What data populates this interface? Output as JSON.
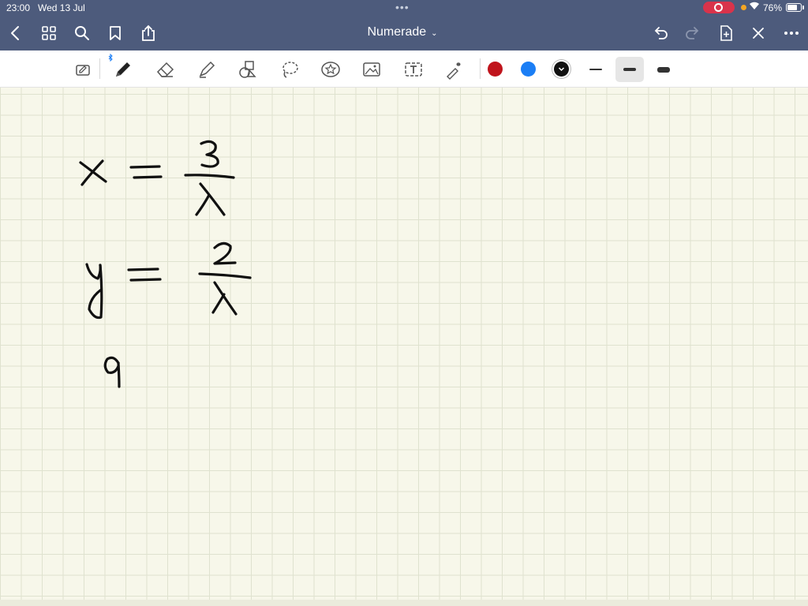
{
  "status_bar": {
    "time": "23:00",
    "date": "Wed 13 Jul",
    "battery_percent": "76%",
    "battery_level": 0.76
  },
  "nav": {
    "title": "Numerade"
  },
  "toolbar": {
    "colors": [
      "#c0141c",
      "#1b7ef5",
      "#111111"
    ],
    "selected_color": "#111111",
    "selected_stroke": "medium"
  }
}
